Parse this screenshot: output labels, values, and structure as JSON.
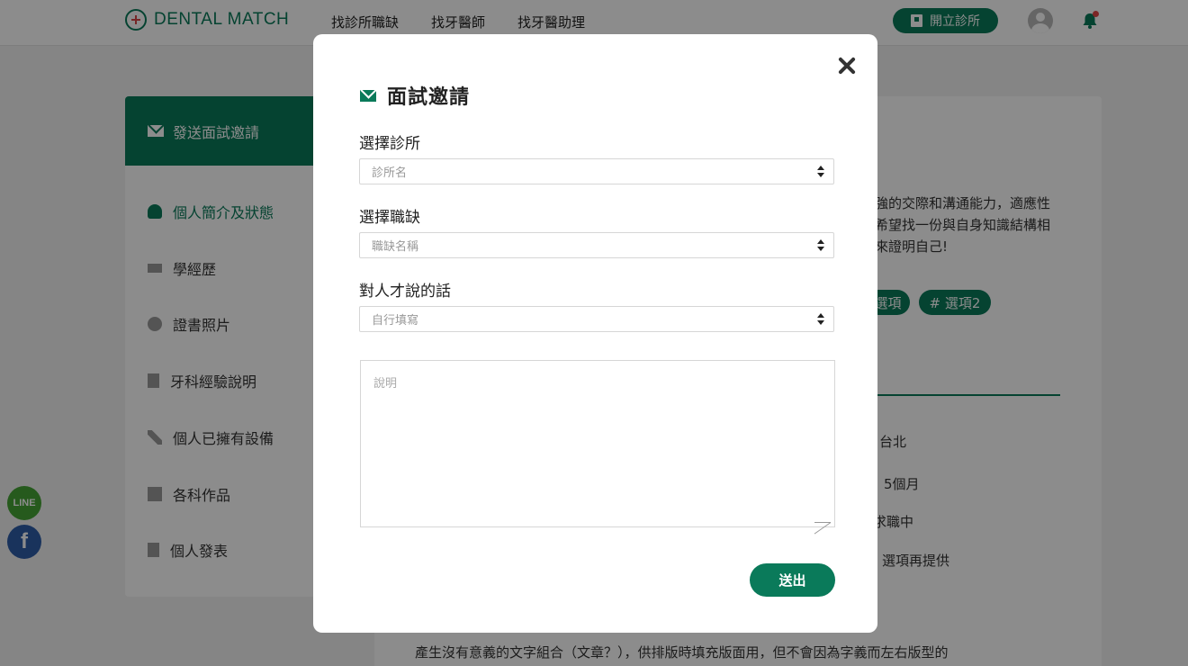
{
  "header": {
    "logo_text": "DENTAL MATCH",
    "nav": [
      "找診所職缺",
      "找牙醫師",
      "找牙醫助理"
    ],
    "open_clinic_label": "開立診所"
  },
  "sidebar": {
    "top_label": "發送面試邀請",
    "items": [
      {
        "label": "個人簡介及狀態",
        "icon": "user-icon"
      },
      {
        "label": "學經歷",
        "icon": "graduation-cap-icon"
      },
      {
        "label": "證書照片",
        "icon": "badge-icon"
      },
      {
        "label": "牙科經驗說明",
        "icon": "clipboard-icon"
      },
      {
        "label": "個人已擁有設備",
        "icon": "tools-icon"
      },
      {
        "label": "各科作品",
        "icon": "copy-icon"
      },
      {
        "label": "個人發表",
        "icon": "file-icon"
      }
    ]
  },
  "card": {
    "lines": [
      "強的交際和溝通能力，適應性",
      "希望找一份與自身知識結構相",
      "來證明自己!"
    ],
    "tags": [
      "選項",
      "# 選項2"
    ],
    "info": [
      "台北",
      "5個月",
      "求職中",
      "選項再提供"
    ],
    "bottom_text": "產生沒有意義的文字組合（文章？），供排版時填充版面用，但不會因為字義而左右版型的"
  },
  "social": {
    "line": "LINE",
    "facebook": "f"
  },
  "modal": {
    "title": "面試邀請",
    "fields": [
      {
        "label": "選擇診所",
        "placeholder": "診所名"
      },
      {
        "label": "選擇職缺",
        "placeholder": "職缺名稱"
      },
      {
        "label": "對人才說的話",
        "placeholder": "自行填寫"
      }
    ],
    "textarea_placeholder": "說明",
    "submit_label": "送出"
  },
  "colors": {
    "brand": "#0a7a5a",
    "alert": "#e24545"
  }
}
